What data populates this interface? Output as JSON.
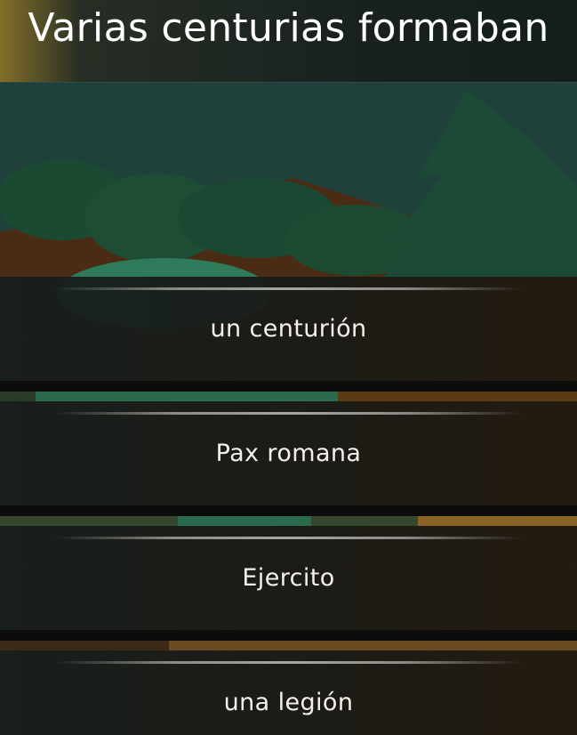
{
  "question": "Varias centurias formaban",
  "answers": [
    {
      "label": "un centurión"
    },
    {
      "label": "Pax romana"
    },
    {
      "label": "Ejercito"
    },
    {
      "label": "una legión"
    }
  ],
  "colors": {
    "panel": "#1a1c18",
    "text": "#ffffff",
    "divider": "#9c9c98",
    "foliage": "#1e4a35",
    "ground": "#4a2c14"
  }
}
